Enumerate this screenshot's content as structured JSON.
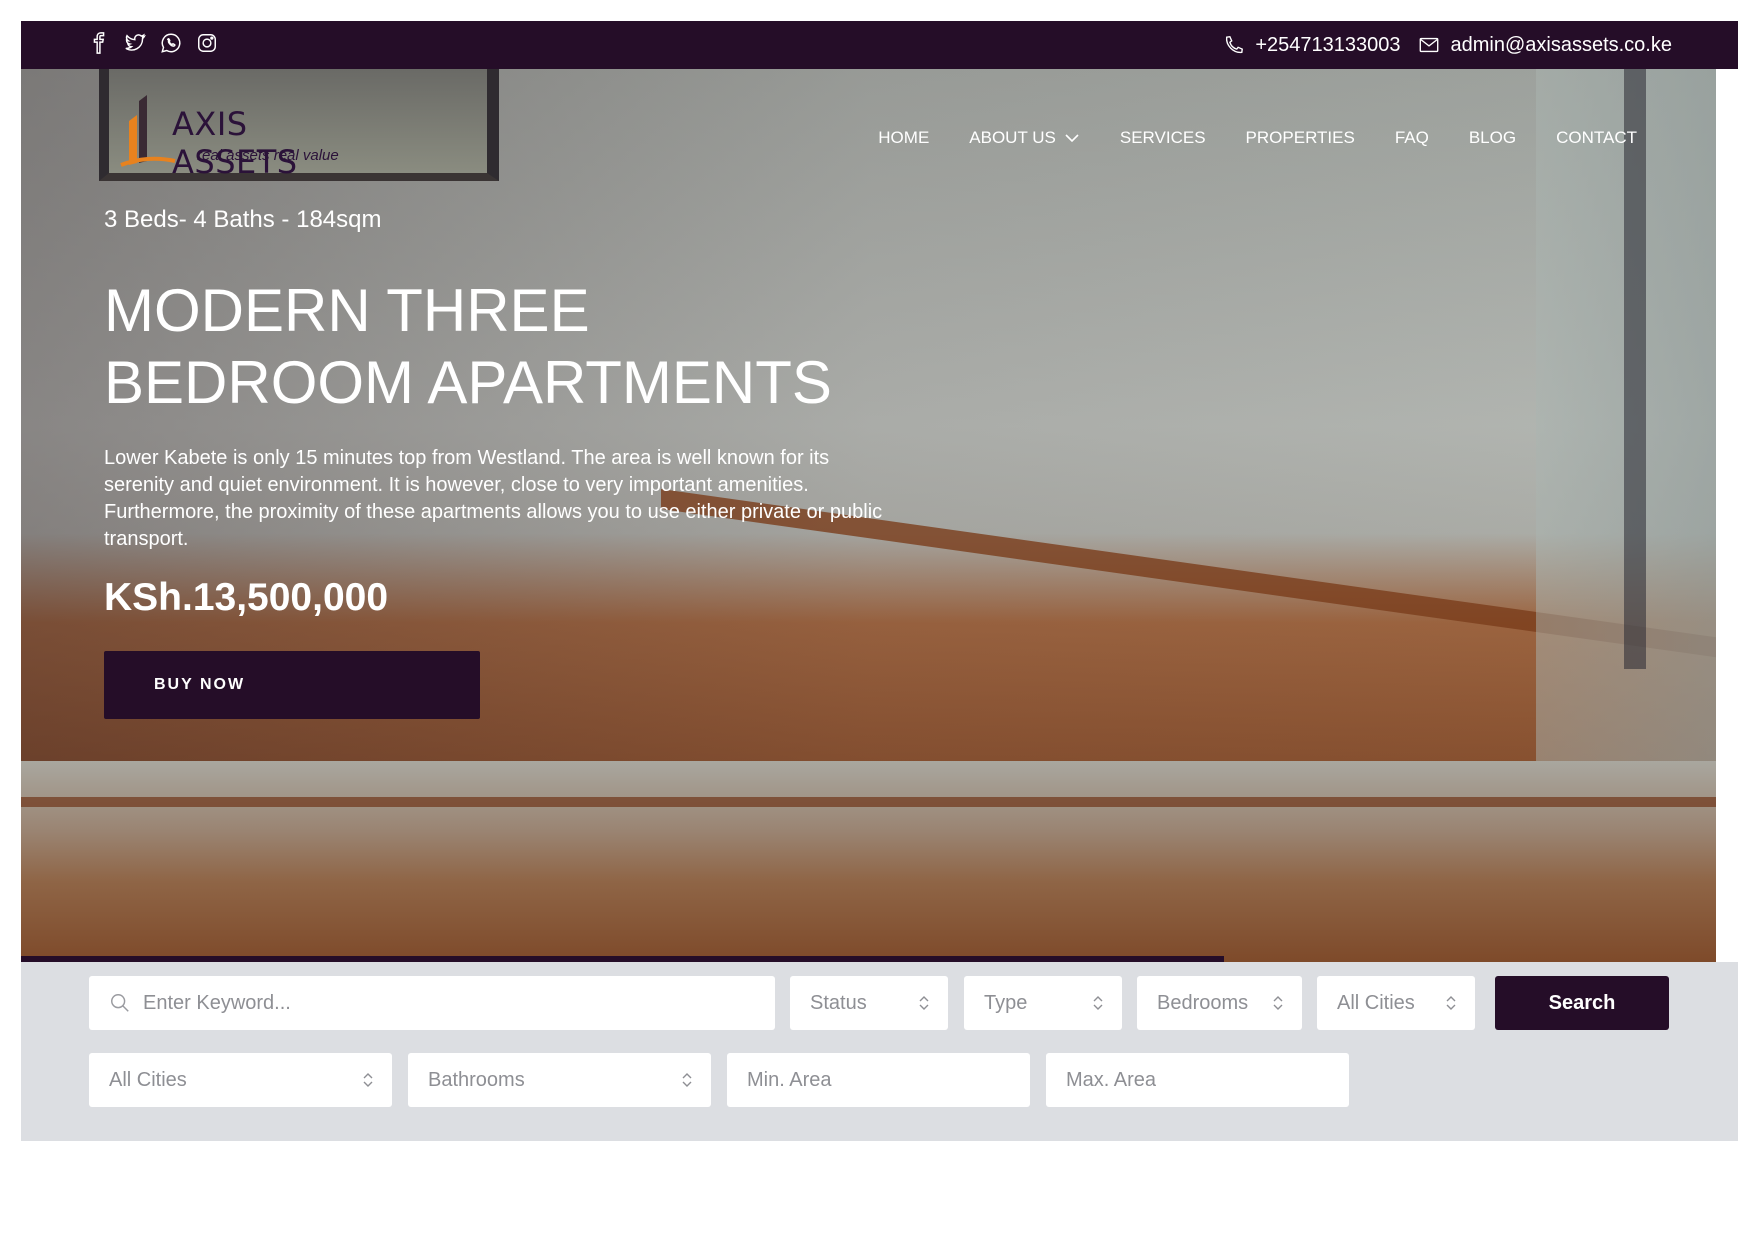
{
  "topbar": {
    "social_icons": [
      "facebook-icon",
      "twitter-icon",
      "whatsapp-icon",
      "instagram-icon"
    ],
    "phone": "+254713133003",
    "email": "admin@axisassets.co.ke"
  },
  "header": {
    "logo_name": "AXIS ASSETS",
    "logo_tagline": "real assets real value",
    "nav": [
      "HOME",
      "ABOUT US",
      "SERVICES",
      "PROPERTIES",
      "FAQ",
      "BLOG",
      "CONTACT"
    ]
  },
  "hero": {
    "specs": "3 Beds- 4 Baths - 184sqm",
    "title": "MODERN THREE BEDROOM APARTMENTS",
    "description": "Lower Kabete is only 15 minutes top from Westland. The area is well known for its serenity and quiet environment. It is however, close to very important amenities. Furthermore, the proximity of these apartments allows you to use either private or public transport.",
    "price": "KSh.13,500,000",
    "cta": "BUY NOW",
    "slider_progress": 0.71
  },
  "search": {
    "keyword_placeholder": "Enter Keyword...",
    "status": "Status",
    "type": "Type",
    "bedrooms": "Bedrooms",
    "cities1": "All Cities",
    "button": "Search",
    "cities2": "All Cities",
    "bathrooms": "Bathrooms",
    "min_area_placeholder": "Min. Area",
    "max_area_placeholder": "Max. Area"
  },
  "colors": {
    "brand_dark": "#250d28",
    "panel_bg": "#dcdee2",
    "logo_orange": "#e8821e"
  }
}
